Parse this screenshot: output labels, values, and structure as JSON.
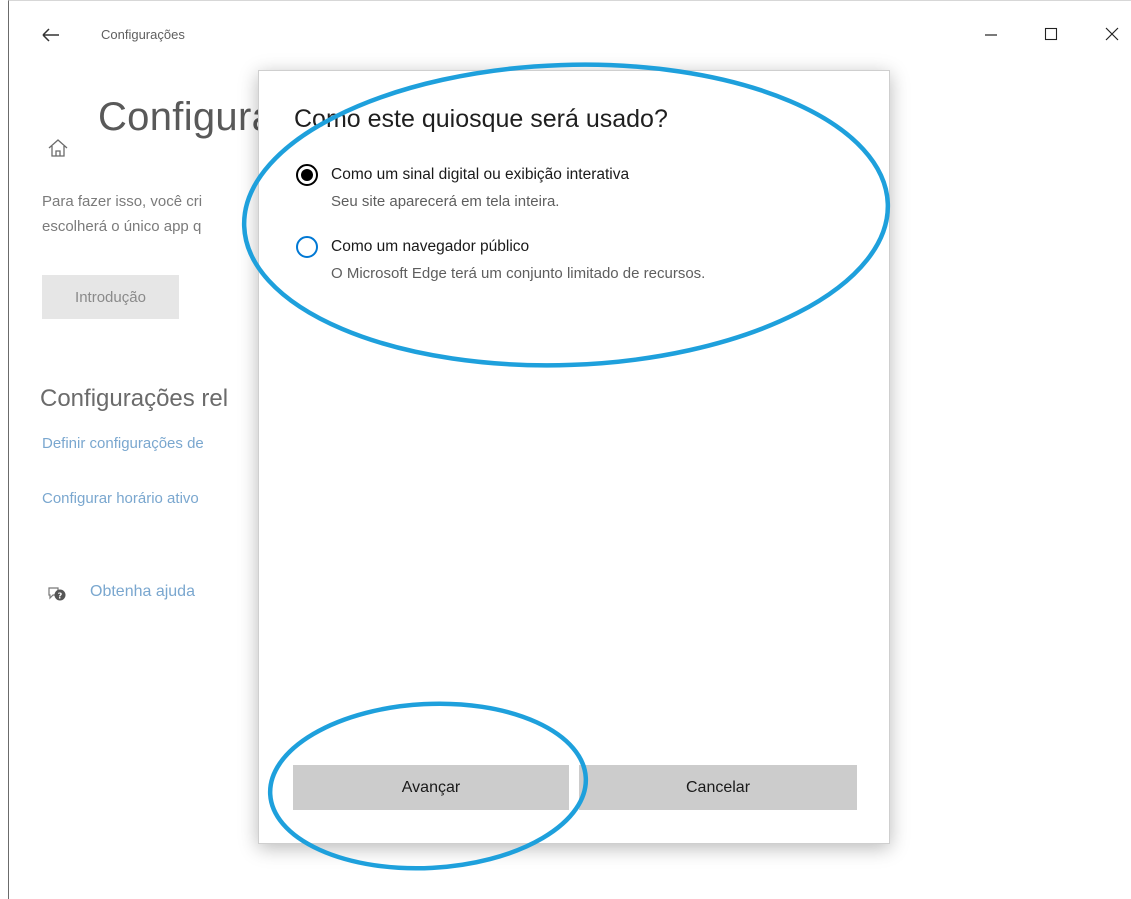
{
  "window": {
    "title": "Configurações",
    "controls": [
      "minimize-icon",
      "maximize-icon",
      "close-icon"
    ]
  },
  "background_page": {
    "title": "Configura",
    "description_line1": "Para fazer isso, você cri",
    "description_line2": "escolherá o único app q",
    "intro_button": "Introdução",
    "related_title": "Configurações rel",
    "related_links": [
      "Definir configurações de",
      "Configurar horário ativo"
    ],
    "help_link": "Obtenha ajuda"
  },
  "dialog": {
    "title": "Como este quiosque será usado?",
    "options": [
      {
        "label": "Como um sinal digital ou exibição interativa",
        "description": "Seu site aparecerá em tela inteira.",
        "selected": true
      },
      {
        "label": "Como um navegador público",
        "description": "O Microsoft Edge terá um conjunto limitado de recursos.",
        "selected": false
      }
    ],
    "next_button": "Avançar",
    "cancel_button": "Cancelar"
  },
  "colors": {
    "accent": "#0078d4",
    "link": "#7aa7cf",
    "highlight_ellipse": "#1ea0dc",
    "button_bg": "#cccccc"
  }
}
